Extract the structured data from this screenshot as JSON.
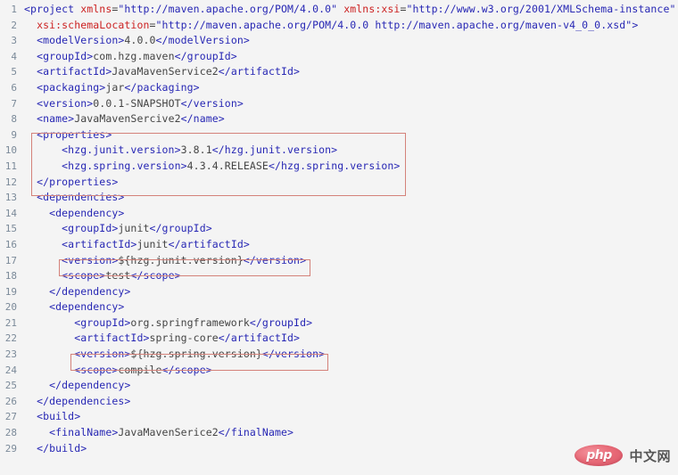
{
  "editor": {
    "background_color": "#f4f4f4",
    "gutter_color": "#7b8a99",
    "tag_color": "#2727b4",
    "attribute_color": "#cc2222",
    "text_color": "#333333",
    "highlight_border_color": "#d4827a",
    "language": "xml",
    "total_lines": 29
  },
  "lines": [
    {
      "number": "1",
      "segments": [
        {
          "cls": "tag",
          "t": "<project "
        },
        {
          "cls": "attr",
          "t": "xmlns"
        },
        {
          "cls": "txt",
          "t": "="
        },
        {
          "cls": "val",
          "t": "\"http://maven.apache.org/POM/4.0.0\""
        },
        {
          "cls": "txt",
          "t": " "
        },
        {
          "cls": "attr",
          "t": "xmlns:xsi"
        },
        {
          "cls": "txt",
          "t": "="
        },
        {
          "cls": "val",
          "t": "\"http://www.w3.org/2001/XMLSchema-instance\""
        }
      ]
    },
    {
      "number": "2",
      "segments": [
        {
          "cls": "txt",
          "t": "  "
        },
        {
          "cls": "attr",
          "t": "xsi:schemaLocation"
        },
        {
          "cls": "txt",
          "t": "="
        },
        {
          "cls": "val",
          "t": "\"http://maven.apache.org/POM/4.0.0 http://maven.apache.org/maven-v4_0_0.xsd\""
        },
        {
          "cls": "tag",
          "t": ">"
        }
      ]
    },
    {
      "number": "3",
      "segments": [
        {
          "cls": "txt",
          "t": "  "
        },
        {
          "cls": "tag",
          "t": "<modelVersion>"
        },
        {
          "cls": "txt",
          "t": "4.0.0"
        },
        {
          "cls": "tag",
          "t": "</modelVersion>"
        }
      ]
    },
    {
      "number": "4",
      "segments": [
        {
          "cls": "txt",
          "t": "  "
        },
        {
          "cls": "tag",
          "t": "<groupId>"
        },
        {
          "cls": "txt",
          "t": "com.hzg.maven"
        },
        {
          "cls": "tag",
          "t": "</groupId>"
        }
      ]
    },
    {
      "number": "5",
      "segments": [
        {
          "cls": "txt",
          "t": "  "
        },
        {
          "cls": "tag",
          "t": "<artifactId>"
        },
        {
          "cls": "txt",
          "t": "JavaMavenService2"
        },
        {
          "cls": "tag",
          "t": "</artifactId>"
        }
      ]
    },
    {
      "number": "6",
      "segments": [
        {
          "cls": "txt",
          "t": "  "
        },
        {
          "cls": "tag",
          "t": "<packaging>"
        },
        {
          "cls": "txt",
          "t": "jar"
        },
        {
          "cls": "tag",
          "t": "</packaging>"
        }
      ]
    },
    {
      "number": "7",
      "segments": [
        {
          "cls": "txt",
          "t": "  "
        },
        {
          "cls": "tag",
          "t": "<version>"
        },
        {
          "cls": "txt",
          "t": "0.0.1-SNAPSHOT"
        },
        {
          "cls": "tag",
          "t": "</version>"
        }
      ]
    },
    {
      "number": "8",
      "segments": [
        {
          "cls": "txt",
          "t": "  "
        },
        {
          "cls": "tag",
          "t": "<name>"
        },
        {
          "cls": "txt",
          "t": "JavaMavenSercive2"
        },
        {
          "cls": "tag",
          "t": "</name>"
        }
      ]
    },
    {
      "number": "9",
      "segments": [
        {
          "cls": "txt",
          "t": "  "
        },
        {
          "cls": "tag",
          "t": "<properties>"
        }
      ]
    },
    {
      "number": "10",
      "segments": [
        {
          "cls": "txt",
          "t": "      "
        },
        {
          "cls": "tag",
          "t": "<hzg.junit.version>"
        },
        {
          "cls": "txt",
          "t": "3.8.1"
        },
        {
          "cls": "tag",
          "t": "</hzg.junit.version>"
        }
      ]
    },
    {
      "number": "11",
      "segments": [
        {
          "cls": "txt",
          "t": "      "
        },
        {
          "cls": "tag",
          "t": "<hzg.spring.version>"
        },
        {
          "cls": "txt",
          "t": "4.3.4.RELEASE"
        },
        {
          "cls": "tag",
          "t": "</hzg.spring.version>"
        }
      ]
    },
    {
      "number": "12",
      "segments": [
        {
          "cls": "txt",
          "t": "  "
        },
        {
          "cls": "tag",
          "t": "</properties>"
        }
      ]
    },
    {
      "number": "13",
      "segments": [
        {
          "cls": "txt",
          "t": "  "
        },
        {
          "cls": "tag",
          "t": "<dependencies>"
        }
      ]
    },
    {
      "number": "14",
      "segments": [
        {
          "cls": "txt",
          "t": "    "
        },
        {
          "cls": "tag",
          "t": "<dependency>"
        }
      ]
    },
    {
      "number": "15",
      "segments": [
        {
          "cls": "txt",
          "t": "      "
        },
        {
          "cls": "tag",
          "t": "<groupId>"
        },
        {
          "cls": "txt",
          "t": "junit"
        },
        {
          "cls": "tag",
          "t": "</groupId>"
        }
      ]
    },
    {
      "number": "16",
      "segments": [
        {
          "cls": "txt",
          "t": "      "
        },
        {
          "cls": "tag",
          "t": "<artifactId>"
        },
        {
          "cls": "txt",
          "t": "junit"
        },
        {
          "cls": "tag",
          "t": "</artifactId>"
        }
      ]
    },
    {
      "number": "17",
      "segments": [
        {
          "cls": "txt",
          "t": "      "
        },
        {
          "cls": "tag",
          "t": "<version>"
        },
        {
          "cls": "txt",
          "t": "${hzg.junit.version}"
        },
        {
          "cls": "tag",
          "t": "</version>"
        }
      ]
    },
    {
      "number": "18",
      "segments": [
        {
          "cls": "txt",
          "t": "      "
        },
        {
          "cls": "tag",
          "t": "<scope>"
        },
        {
          "cls": "txt",
          "t": "test"
        },
        {
          "cls": "tag",
          "t": "</scope>"
        }
      ]
    },
    {
      "number": "19",
      "segments": [
        {
          "cls": "txt",
          "t": "    "
        },
        {
          "cls": "tag",
          "t": "</dependency>"
        }
      ]
    },
    {
      "number": "20",
      "segments": [
        {
          "cls": "txt",
          "t": "    "
        },
        {
          "cls": "tag",
          "t": "<dependency>"
        }
      ]
    },
    {
      "number": "21",
      "segments": [
        {
          "cls": "txt",
          "t": "        "
        },
        {
          "cls": "tag",
          "t": "<groupId>"
        },
        {
          "cls": "txt",
          "t": "org.springframework"
        },
        {
          "cls": "tag",
          "t": "</groupId>"
        }
      ]
    },
    {
      "number": "22",
      "segments": [
        {
          "cls": "txt",
          "t": "        "
        },
        {
          "cls": "tag",
          "t": "<artifactId>"
        },
        {
          "cls": "txt",
          "t": "spring-core"
        },
        {
          "cls": "tag",
          "t": "</artifactId>"
        }
      ]
    },
    {
      "number": "23",
      "segments": [
        {
          "cls": "txt",
          "t": "        "
        },
        {
          "cls": "tag",
          "t": "<version>"
        },
        {
          "cls": "txt",
          "t": "${hzg.spring.version}"
        },
        {
          "cls": "tag",
          "t": "</version>"
        }
      ]
    },
    {
      "number": "24",
      "segments": [
        {
          "cls": "txt",
          "t": "        "
        },
        {
          "cls": "tag",
          "t": "<scope>"
        },
        {
          "cls": "txt",
          "t": "compile"
        },
        {
          "cls": "tag",
          "t": "</scope>"
        }
      ]
    },
    {
      "number": "25",
      "segments": [
        {
          "cls": "txt",
          "t": "    "
        },
        {
          "cls": "tag",
          "t": "</dependency>"
        }
      ]
    },
    {
      "number": "26",
      "segments": [
        {
          "cls": "txt",
          "t": "  "
        },
        {
          "cls": "tag",
          "t": "</dependencies>"
        }
      ]
    },
    {
      "number": "27",
      "segments": [
        {
          "cls": "txt",
          "t": "  "
        },
        {
          "cls": "tag",
          "t": "<build>"
        }
      ]
    },
    {
      "number": "28",
      "segments": [
        {
          "cls": "txt",
          "t": "    "
        },
        {
          "cls": "tag",
          "t": "<finalName>"
        },
        {
          "cls": "txt",
          "t": "JavaMavenSerice2"
        },
        {
          "cls": "tag",
          "t": "</finalName>"
        }
      ]
    },
    {
      "number": "29",
      "segments": [
        {
          "cls": "txt",
          "t": "  "
        },
        {
          "cls": "tag",
          "t": "</build>"
        }
      ]
    }
  ],
  "annotations": [
    {
      "id": "hl-properties",
      "label": "properties-block-highlight",
      "lines": "9-12"
    },
    {
      "id": "hl-junit-version",
      "label": "junit-version-highlight",
      "lines": "17"
    },
    {
      "id": "hl-spring-version",
      "label": "spring-version-highlight",
      "lines": "23"
    }
  ],
  "watermark": {
    "badge_text": "php",
    "site_text": "中文网",
    "badge_color": "#e8616f"
  }
}
